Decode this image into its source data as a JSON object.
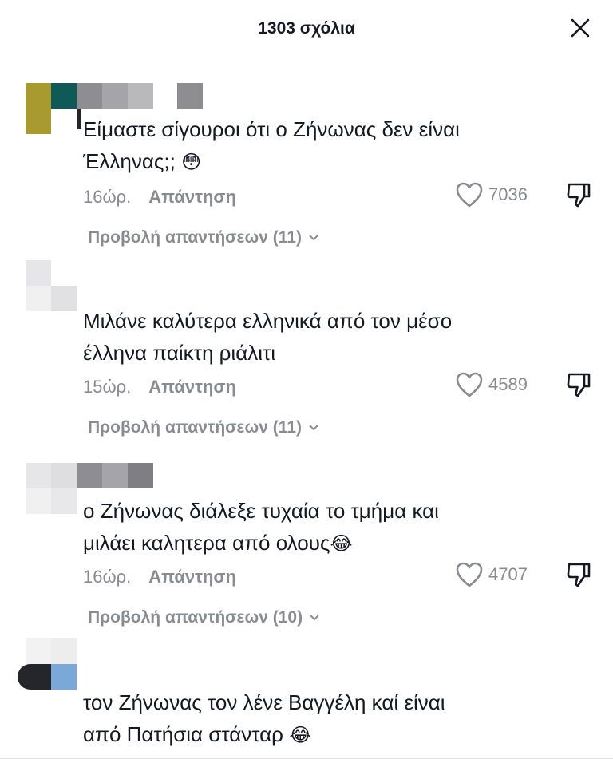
{
  "header": {
    "title": "1303 σχόλια",
    "close_icon": "close-icon"
  },
  "comments": [
    {
      "text_line1": "Είμαστε σίγουροι ότι ο Ζήνωνας δεν είναι",
      "text_line2": "Έλληνας;;",
      "emoji": "😳",
      "time": "16ώρ.",
      "reply_label": "Απάντηση",
      "likes": "7036",
      "view_replies": "Προβολή απαντήσεων (11)"
    },
    {
      "text_line1": "Μιλάνε καλύτερα ελληνικά από τον μέσο",
      "text_line2": "έλληνα παίκτη ριάλιτι",
      "emoji": "",
      "time": "15ώρ.",
      "reply_label": "Απάντηση",
      "likes": "4589",
      "view_replies": "Προβολή απαντήσεων (11)"
    },
    {
      "text_line1": "ο Ζήνωνας διάλεξε τυχαία το τμήμα και",
      "text_line2": "μιλάει καλητερα από ολους",
      "emoji": "😂",
      "time": "16ώρ.",
      "reply_label": "Απάντηση",
      "likes": "4707",
      "view_replies": "Προβολή απαντήσεων (10)"
    },
    {
      "text_line1": "τον Ζήνωνας τον λένε Βαγγέλη καί είναι",
      "text_line2": "από Πατήσια στάνταρ",
      "emoji": "😂"
    }
  ],
  "colors": {
    "text": "#161823",
    "muted": "#8a8b91",
    "pixel_olive": "#a89a2e",
    "pixel_teal": "#0f5a56",
    "pixel_gray": "#8d8d92",
    "pixel_light": "#e6e6e8",
    "pixel_blue": "#7aa9d8",
    "pixel_dark": "#24262c"
  }
}
